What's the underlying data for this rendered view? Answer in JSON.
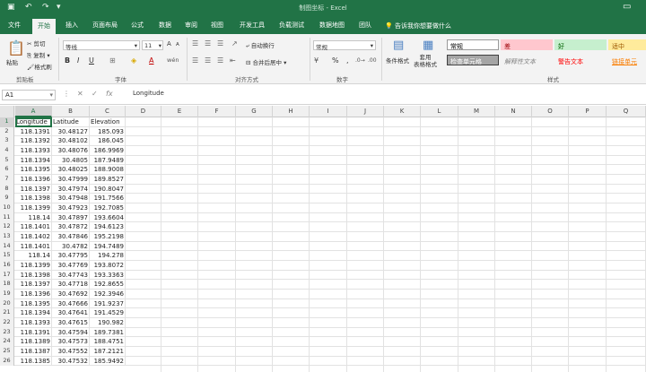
{
  "titlebar": {
    "title": "制图坐标 - Excel",
    "save_icon": "save-icon",
    "undo_icon": "undo-icon",
    "redo_icon": "redo-icon"
  },
  "tabs": [
    "文件",
    "开始",
    "插入",
    "页面布局",
    "公式",
    "数据",
    "审阅",
    "视图",
    "开发工具",
    "负载测试",
    "数据地图",
    "团队"
  ],
  "active_tab": "开始",
  "tellme": "告诉我你想要做什么",
  "ribbon": {
    "clipboard": {
      "paste": "粘贴",
      "cut": "剪切",
      "copy": "复制",
      "format_painter": "格式刷",
      "label": "剪贴板"
    },
    "font": {
      "font_name": "等线",
      "font_size": "11",
      "label": "字体",
      "grow": "A",
      "shrink": "A",
      "bold": "B",
      "italic": "I",
      "underline": "U",
      "wen": "wén"
    },
    "alignment": {
      "wrap": "自动换行",
      "merge": "合并后居中",
      "label": "对齐方式"
    },
    "number": {
      "format": "常规",
      "percent": "%",
      "comma": ",",
      "label": "数字"
    },
    "styles": {
      "cond_format": "条件格式",
      "table_format": "套用\n表格格式",
      "label": "样式",
      "cells": [
        {
          "text": "常规",
          "bg": "#ffffff",
          "fg": "#000000",
          "border": "#9a9a9a"
        },
        {
          "text": "差",
          "bg": "#ffc7ce",
          "fg": "#9c0006",
          "border": "#ffc7ce"
        },
        {
          "text": "好",
          "bg": "#c6efce",
          "fg": "#006100",
          "border": "#c6efce"
        },
        {
          "text": "适中",
          "bg": "#ffeb9c",
          "fg": "#9c5700",
          "border": "#ffeb9c"
        },
        {
          "text": "检查单元格",
          "bg": "#a5a5a5",
          "fg": "#ffffff",
          "border": "#3f3f3f"
        },
        {
          "text": "解释性文本",
          "bg": "#f3f3f3",
          "fg": "#7f7f7f",
          "border": "#f3f3f3"
        },
        {
          "text": "警告文本",
          "bg": "#f3f3f3",
          "fg": "#ff0000",
          "border": "#f3f3f3"
        },
        {
          "text": "链接单元",
          "bg": "#f3f3f3",
          "fg": "#fa7d00",
          "border": "#f3f3f3"
        }
      ]
    }
  },
  "formula_bar": {
    "name_box": "A1",
    "cancel": "✕",
    "enter": "✓",
    "fx": "fx",
    "content": "Longitude"
  },
  "columns": [
    "A",
    "B",
    "C",
    "D",
    "E",
    "F",
    "G",
    "H",
    "I",
    "J",
    "K",
    "L",
    "M",
    "N",
    "O",
    "P",
    "Q"
  ],
  "rows": [
    {
      "n": "1",
      "a": "Longitude",
      "b": "Latitude",
      "c": "Elevation"
    },
    {
      "n": "2",
      "a": "118.1391",
      "b": "30.48127",
      "c": "185.093"
    },
    {
      "n": "3",
      "a": "118.1392",
      "b": "30.48102",
      "c": "186.045"
    },
    {
      "n": "4",
      "a": "118.1393",
      "b": "30.48076",
      "c": "186.9969"
    },
    {
      "n": "5",
      "a": "118.1394",
      "b": "30.4805",
      "c": "187.9489"
    },
    {
      "n": "6",
      "a": "118.1395",
      "b": "30.48025",
      "c": "188.9008"
    },
    {
      "n": "7",
      "a": "118.1396",
      "b": "30.47999",
      "c": "189.8527"
    },
    {
      "n": "8",
      "a": "118.1397",
      "b": "30.47974",
      "c": "190.8047"
    },
    {
      "n": "9",
      "a": "118.1398",
      "b": "30.47948",
      "c": "191.7566"
    },
    {
      "n": "10",
      "a": "118.1399",
      "b": "30.47923",
      "c": "192.7085"
    },
    {
      "n": "11",
      "a": "118.14",
      "b": "30.47897",
      "c": "193.6604"
    },
    {
      "n": "12",
      "a": "118.1401",
      "b": "30.47872",
      "c": "194.6123"
    },
    {
      "n": "13",
      "a": "118.1402",
      "b": "30.47846",
      "c": "195.2198"
    },
    {
      "n": "14",
      "a": "118.1401",
      "b": "30.4782",
      "c": "194.7489"
    },
    {
      "n": "15",
      "a": "118.14",
      "b": "30.47795",
      "c": "194.278"
    },
    {
      "n": "16",
      "a": "118.1399",
      "b": "30.47769",
      "c": "193.8072"
    },
    {
      "n": "17",
      "a": "118.1398",
      "b": "30.47743",
      "c": "193.3363"
    },
    {
      "n": "18",
      "a": "118.1397",
      "b": "30.47718",
      "c": "192.8655"
    },
    {
      "n": "19",
      "a": "118.1396",
      "b": "30.47692",
      "c": "192.3946"
    },
    {
      "n": "20",
      "a": "118.1395",
      "b": "30.47666",
      "c": "191.9237"
    },
    {
      "n": "21",
      "a": "118.1394",
      "b": "30.47641",
      "c": "191.4529"
    },
    {
      "n": "22",
      "a": "118.1393",
      "b": "30.47615",
      "c": "190.982"
    },
    {
      "n": "23",
      "a": "118.1391",
      "b": "30.47594",
      "c": "189.7381"
    },
    {
      "n": "24",
      "a": "118.1389",
      "b": "30.47573",
      "c": "188.4751"
    },
    {
      "n": "25",
      "a": "118.1387",
      "b": "30.47552",
      "c": "187.2121"
    },
    {
      "n": "26",
      "a": "118.1385",
      "b": "30.47532",
      "c": "185.9492"
    }
  ]
}
